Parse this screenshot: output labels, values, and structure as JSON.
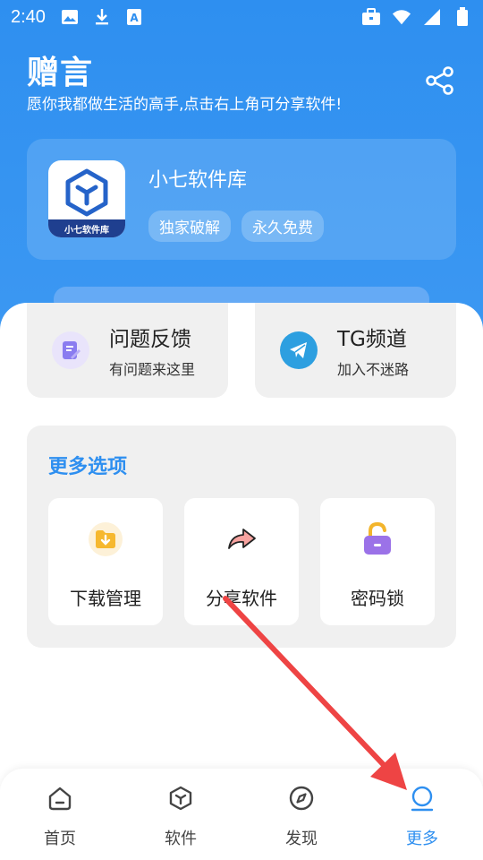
{
  "status_bar": {
    "time": "2:40",
    "left_icons": [
      "image-icon",
      "download-icon",
      "font-icon"
    ],
    "right_icons": [
      "briefcase-icon",
      "wifi-icon",
      "signal-icon",
      "battery-icon"
    ]
  },
  "header": {
    "title": "赠言",
    "subtitle": "愿你我都做生活的高手,点击右上角可分享软件!",
    "share_icon": "share-icon"
  },
  "app_card": {
    "logo_band_text": "小七软件库",
    "name": "小七软件库",
    "tags": [
      "独家破解",
      "永久免费"
    ]
  },
  "quick_cards": [
    {
      "title": "问题反馈",
      "subtitle": "有问题来这里",
      "icon": "feedback-icon",
      "color": "#8a7cf0"
    },
    {
      "title": "TG频道",
      "subtitle": "加入不迷路",
      "icon": "telegram-icon",
      "color": "#2d9fe0"
    }
  ],
  "more_options": {
    "title": "更多选项",
    "items": [
      {
        "label": "下载管理",
        "icon": "folder-download-icon"
      },
      {
        "label": "分享软件",
        "icon": "share-arrow-icon"
      },
      {
        "label": "密码锁",
        "icon": "lock-icon"
      }
    ]
  },
  "bottom_nav": {
    "items": [
      {
        "label": "首页",
        "icon": "home-icon",
        "active": false
      },
      {
        "label": "软件",
        "icon": "cube-icon",
        "active": false
      },
      {
        "label": "发现",
        "icon": "compass-icon",
        "active": false
      },
      {
        "label": "更多",
        "icon": "profile-icon",
        "active": true
      }
    ]
  },
  "colors": {
    "primary": "#2e8ff0",
    "annotation_arrow": "#ee4444"
  }
}
